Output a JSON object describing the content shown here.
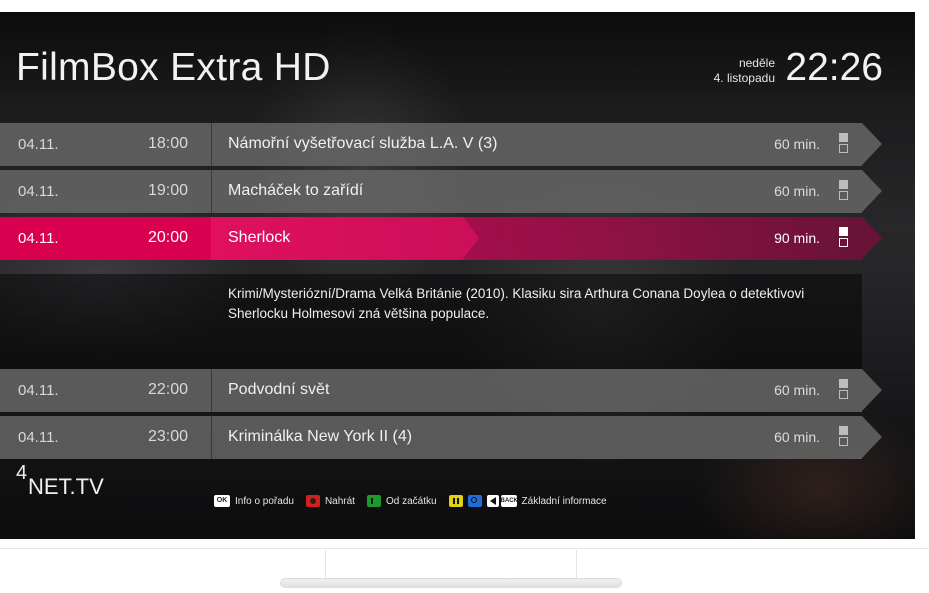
{
  "header": {
    "channel": "FilmBox Extra HD",
    "day": "neděle",
    "date": "4. listopadu",
    "time": "22:26"
  },
  "programs": [
    {
      "date": "04.11.",
      "time": "18:00",
      "title": "Námořní vyšetřovací služba L.A. V (3)",
      "duration": "60 min."
    },
    {
      "date": "04.11.",
      "time": "19:00",
      "title": "Macháček to zařídí",
      "duration": "60 min."
    },
    {
      "date": "04.11.",
      "time": "20:00",
      "title": "Sherlock",
      "duration": "90 min."
    },
    {
      "date": "04.11.",
      "time": "22:00",
      "title": "Podvodní svět",
      "duration": "60 min."
    },
    {
      "date": "04.11.",
      "time": "23:00",
      "title": "Kriminálka New York II (4)",
      "duration": "60 min."
    }
  ],
  "selected_description": "Krimi/Mysteriózní/Drama Velká Británie (2010). Klasiku sira Arthura Conana Doylea o detektivovi Sherlocku Holmesovi zná většina populace.",
  "logo": {
    "sup": "4",
    "main": "NET.TV"
  },
  "legend": {
    "ok_key": "OK",
    "info": "Info o pořadu",
    "record": "Nahrát",
    "from_start": "Od začátku",
    "back_key": "BACK",
    "basic_info": "Základní informace"
  },
  "colors": {
    "accent": "#d8004f",
    "row": "#696969"
  }
}
